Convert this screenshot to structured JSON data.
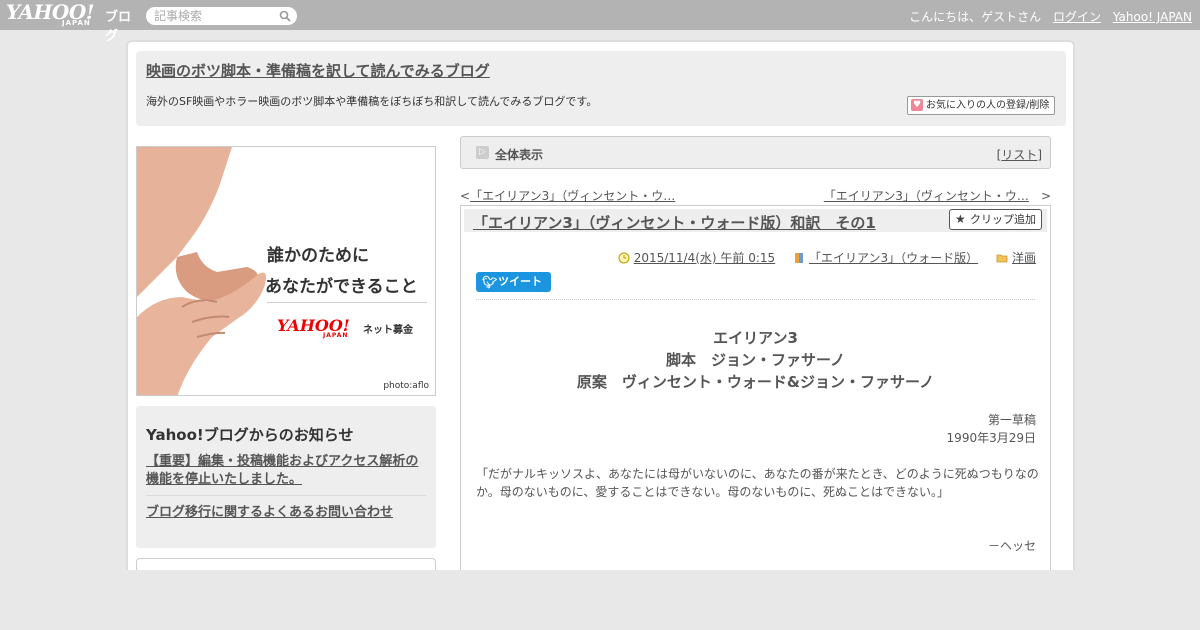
{
  "topbar": {
    "logo_text": "YAHOO!",
    "logo_sub": "JAPAN",
    "blog_label": "ブログ",
    "search_placeholder": "記事検索",
    "greeting": "こんにちは、ゲストさん",
    "login": "ログイン",
    "yahoo_japan": "Yahoo! JAPAN"
  },
  "header": {
    "blog_title": "映画のボツ脚本・準備稿を訳して読んでみるブログ",
    "description": "海外のSF映画やホラー映画のボツ脚本や準備稿をぼちぼち和訳して読んでみるブログです。",
    "favorite_button": "お気に入りの人の登録/削除"
  },
  "banner": {
    "line1": "誰かのために",
    "line2": "あなたができること",
    "logo": "YAHOO!",
    "logo_sub": "JAPAN",
    "service": "ネット募金",
    "credit": "photo:aflo"
  },
  "notice": {
    "title": "Yahoo!ブログからのお知らせ",
    "link1": "【重要】編集・投稿機能およびアクセス解析の機能を停止いたしました。",
    "link2": "ブログ移行に関するよくあるお問い合わせ"
  },
  "listbar": {
    "label": "全体表示",
    "list_open": "[",
    "list_link": "リスト",
    "list_close": "]"
  },
  "nav": {
    "prev_arrow": "<",
    "prev": "「エイリアン3」（ヴィンセント・ウ…",
    "next": "「エイリアン3」（ヴィンセント・ウ…",
    "next_arrow": ">"
  },
  "article": {
    "title": "「エイリアン3」（ヴィンセント・ウォード版）和訳　その1",
    "clip_button": "クリップ追加",
    "date": "2015/11/4(水) 午前 0:15",
    "book": "「エイリアン3」（ウォード版）",
    "category": "洋画",
    "tweet": "ツイート",
    "body_title_lines": [
      "エイリアン3",
      "脚本　ジョン・ファサーノ",
      "原案　ヴィンセント・ウォード&ジョン・ファサーノ"
    ],
    "draft": "第一草稿",
    "draft_date": "1990年3月29日",
    "quote": "「だがナルキッソスよ、あなたには母がいないのに、あなたの番が来たとき、どのように死ぬつもりなのか。母のないものに、愛することはできない。母のないものに、死ぬことはできない。」",
    "author": "－ヘッセ"
  },
  "colors": {
    "topbar": "#b3b3b3",
    "tweet": "#1b95e0",
    "page_bg": "#e8e8e8"
  }
}
